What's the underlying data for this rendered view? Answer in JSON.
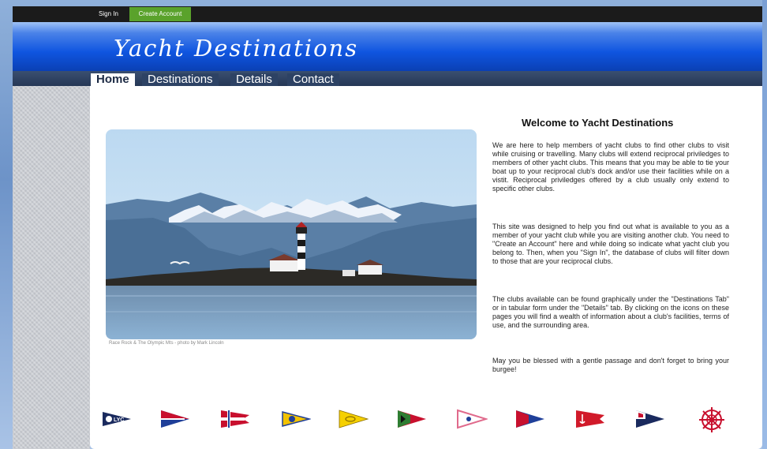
{
  "auth": {
    "sign_in": "Sign In",
    "create_account": "Create Account"
  },
  "site_title": "Yacht Destinations",
  "nav": {
    "tabs": [
      "Home",
      "Destinations",
      "Details",
      "Contact"
    ],
    "active": "Home"
  },
  "photo": {
    "caption": "Race Rock & The Olympic Mts - photo by Mark Lincoln"
  },
  "welcome": {
    "heading": "Welcome to Yacht Destinations",
    "paragraphs": [
      "We are here to help members of yacht clubs to find other clubs to visit while cruising or travelling. Many clubs will extend reciprocal priviledges to members of other yacht clubs. This means that you may be able to tie your boat up to your reciprocal club's dock and/or use their facilities while on a vistit. Reciprocal priviledges offered by a club usually only extend to specific other clubs.",
      "This site was designed to help you find out what is available to you as a member of your yacht club while you are visiting another club. You need to \"Create an Account\" here and while doing so indicate what yacht club you belong to. Then, when you \"Sign In\", the database of clubs will filter down to those that are your reciprocal clubs.",
      "The clubs available can be found graphically under the \"Destinations Tab\" or in tabular form under the \"Details\" tab. By clicking on the icons on these pages you will find a wealth of information about a club's facilities, terms of use, and the surrounding area.",
      "May you be blessed with a gentle passage and don't forget to bring your burgee!"
    ]
  },
  "burgees": [
    {
      "name": "burgee-lyc-icon",
      "label": "LYC",
      "colors": [
        "#1a2a5e",
        "#ffffff"
      ]
    },
    {
      "name": "burgee-red-white-blue-icon",
      "colors": [
        "#c8102e",
        "#ffffff",
        "#1f3f99"
      ]
    },
    {
      "name": "burgee-red-cross-icon",
      "colors": [
        "#c8102e",
        "#ffffff",
        "#1f3f99"
      ]
    },
    {
      "name": "burgee-yellow-blue-icon",
      "colors": [
        "#f2c200",
        "#1f3f99"
      ]
    },
    {
      "name": "burgee-yellow-icon",
      "colors": [
        "#f5d000",
        "#8a6d00"
      ]
    },
    {
      "name": "burgee-green-red-icon",
      "colors": [
        "#2e7d32",
        "#c8102e",
        "#111111"
      ]
    },
    {
      "name": "burgee-pink-white-icon",
      "colors": [
        "#ffffff",
        "#e06a8c",
        "#1f3f99"
      ]
    },
    {
      "name": "burgee-red-blue-icon",
      "colors": [
        "#c8102e",
        "#1f3f99",
        "#ffffff"
      ]
    },
    {
      "name": "burgee-red-anchor-icon",
      "colors": [
        "#d11a2a",
        "#ffffff"
      ]
    },
    {
      "name": "burgee-navy-red-icon",
      "colors": [
        "#1a2a5e",
        "#ffffff",
        "#c8102e"
      ]
    },
    {
      "name": "ship-wheel-icon",
      "colors": [
        "#c8102e",
        "#ffffff"
      ]
    }
  ]
}
